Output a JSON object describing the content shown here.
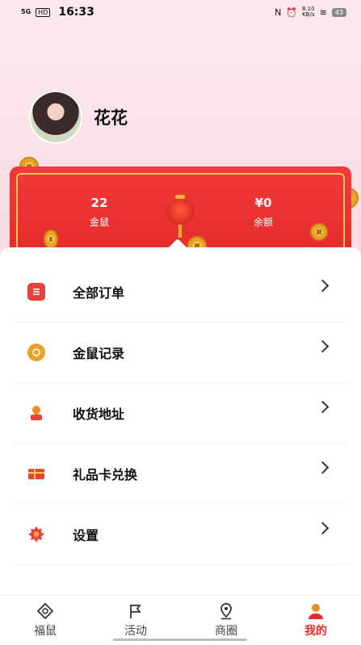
{
  "status_bar": {
    "signal": "5G",
    "hd": "HD",
    "time": "16:33",
    "icons": [
      "nfc-icon",
      "alarm-icon",
      "wifi-icon"
    ],
    "net_speed": "8.10\nKB/s",
    "battery": "43"
  },
  "profile": {
    "username": "花花"
  },
  "stats": {
    "gold": {
      "value": "22",
      "label": "金鼠"
    },
    "balance": {
      "value": "¥0",
      "label": "余额"
    }
  },
  "menu": [
    {
      "label": "全部订单",
      "icon": "orders-icon",
      "color": "#e8423c"
    },
    {
      "label": "金鼠记录",
      "icon": "coin-record-icon",
      "color": "#e9a22a"
    },
    {
      "label": "收货地址",
      "icon": "location-icon",
      "color": "#e8423c"
    },
    {
      "label": "礼品卡兑换",
      "icon": "gift-card-icon",
      "color": "#e8423c"
    },
    {
      "label": "设置",
      "icon": "settings-icon",
      "color": "#e8423c"
    }
  ],
  "tabs": [
    {
      "label": "福鼠",
      "icon": "home-icon",
      "active": false
    },
    {
      "label": "活动",
      "icon": "flag-icon",
      "active": false
    },
    {
      "label": "商圈",
      "icon": "map-pin-icon",
      "active": false
    },
    {
      "label": "我的",
      "icon": "user-icon",
      "active": true
    }
  ],
  "colors": {
    "accent": "#e52a2a",
    "card_red": "#f23a3a",
    "gold_border": "#ffc55a"
  }
}
